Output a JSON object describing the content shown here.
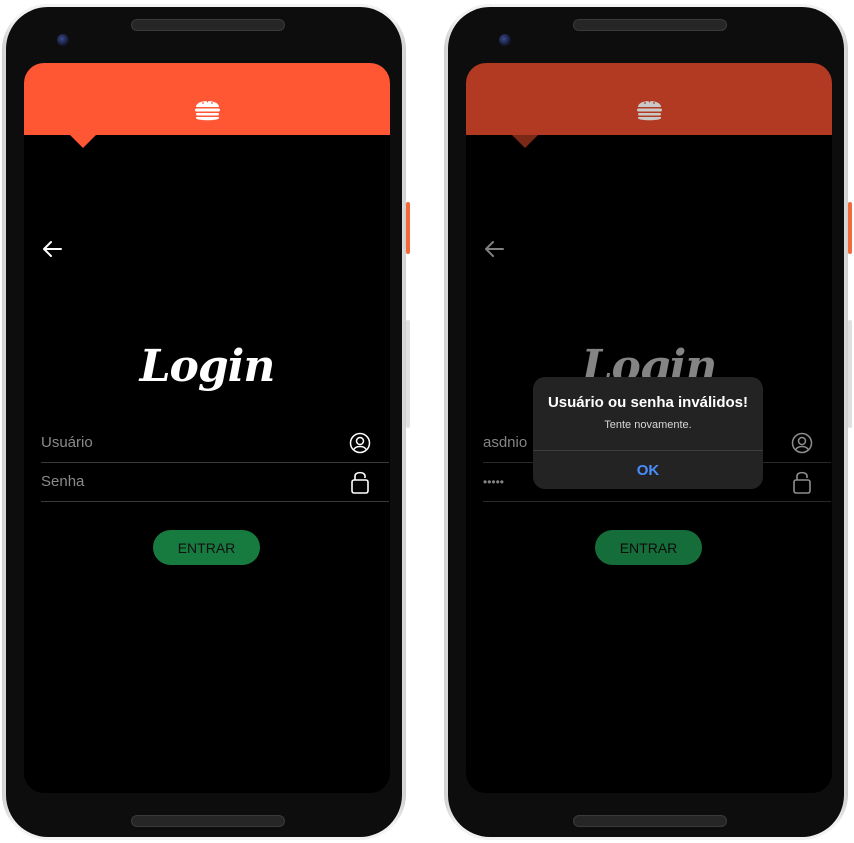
{
  "colors": {
    "brand": "#ff5733",
    "brand_dimmed": "#b23a22",
    "button_green": "#177a3f",
    "button_green_bright": "#1f9e52",
    "dialog_accent": "#4a8dff"
  },
  "icons": {
    "header": "burger-icon",
    "back": "arrow-left-icon",
    "user": "user-circle-icon",
    "password": "lock-icon"
  },
  "screen_left": {
    "title": "Login",
    "username_placeholder": "Usuário",
    "password_placeholder": "Senha",
    "submit_label": "ENTRAR"
  },
  "screen_right": {
    "title": "Login",
    "username_value": "asdnio",
    "password_value": "•••••",
    "submit_label": "ENTRAR",
    "dialog": {
      "title": "Usuário ou senha inválidos!",
      "message": "Tente novamente.",
      "ok_label": "OK"
    }
  }
}
